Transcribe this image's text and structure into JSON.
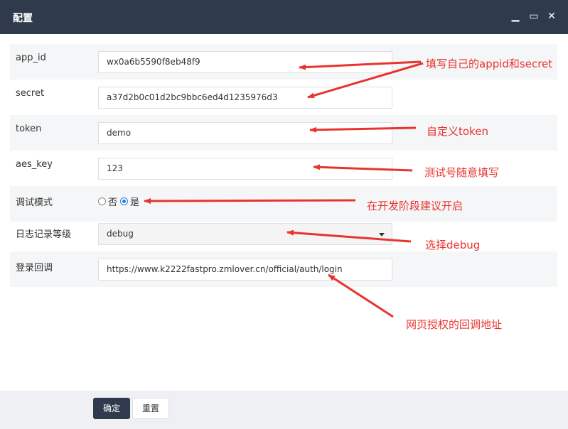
{
  "dialog": {
    "title": "配置",
    "controls": {
      "minimize": "▁",
      "maximize": "▭",
      "close": "✕"
    }
  },
  "form": {
    "rows": [
      {
        "label": "app_id",
        "value": "wx0a6b5590f8eb48f9"
      },
      {
        "label": "secret",
        "value": "a37d2b0c01d2bc9bbc6ed4d1235976d3"
      },
      {
        "label": "token",
        "value": "demo"
      },
      {
        "label": "aes_key",
        "value": "123"
      },
      {
        "label": "调试模式",
        "options": [
          "否",
          "是"
        ],
        "selected": "是"
      },
      {
        "label": "日志记录等级",
        "value": "debug"
      },
      {
        "label": "登录回调",
        "value": "https://www.k2222fastpro.zmlover.cn/official/auth/login"
      }
    ]
  },
  "buttons": {
    "confirm": "确定",
    "reset": "重置"
  },
  "annotations": {
    "appid_secret": "填写自己的appid和secret",
    "token": "自定义token",
    "aes_key": "测试号随意填写",
    "debug_mode": "在开发阶段建议开启",
    "log_level": "选择debug",
    "callback": "网页授权的回调地址"
  },
  "colors": {
    "titlebar": "#2f3b4d",
    "annotation": "#e8342e",
    "radio_selected": "#1e7ee6"
  }
}
